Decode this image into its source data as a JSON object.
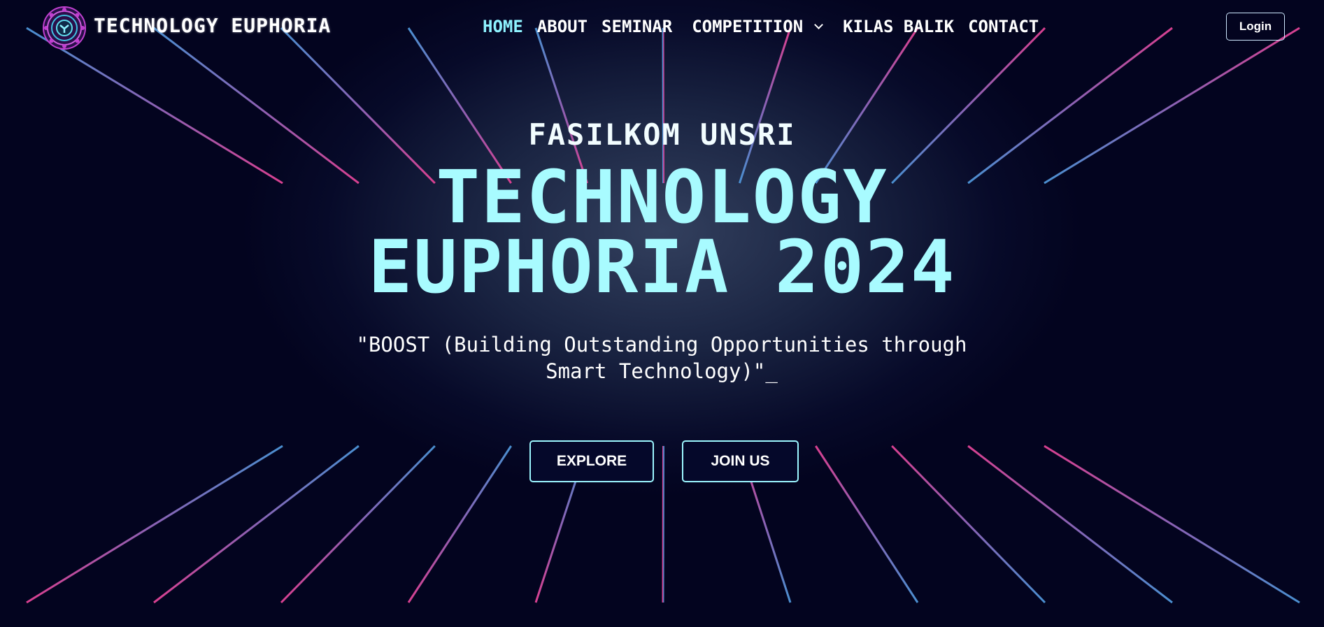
{
  "nav": {
    "brand": "TECHNOLOGY EUPHORIA",
    "items": [
      {
        "label": "HOME",
        "active": true
      },
      {
        "label": "ABOUT",
        "active": false
      },
      {
        "label": "SEMINAR",
        "active": false
      },
      {
        "label": "COMPETITION",
        "active": false,
        "dropdown": true
      },
      {
        "label": "KILAS BALIK",
        "active": false
      },
      {
        "label": "CONTACT",
        "active": false
      }
    ],
    "login_label": "Login"
  },
  "hero": {
    "subtitle": "FASILKOM UNSRI",
    "title_line1": "TECHNOLOGY",
    "title_line2": "EUPHORIA 2024",
    "tagline_line1": "\"BOOST (Building Outstanding Opportunities through",
    "tagline_line2": "Smart Technology)\"_",
    "explore_label": "EXPLORE",
    "join_label": "JOIN US"
  },
  "colors": {
    "background": "#03041f",
    "accent": "#a8fbff",
    "active_nav": "#8ef2ff",
    "grid_blue": "#4a8fd0",
    "grid_pink": "#d04090"
  },
  "icons": {
    "logo": "mandala-logo-icon",
    "dropdown": "chevron-down-icon"
  }
}
